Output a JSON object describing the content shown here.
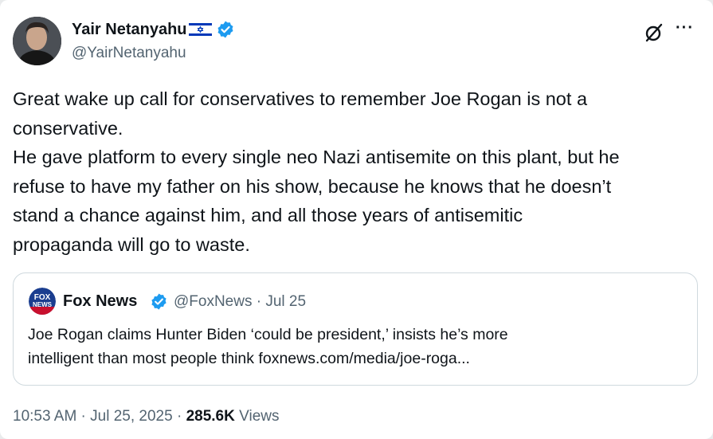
{
  "author": {
    "display_name": "Yair Netanyahu",
    "flag_icon": "israel-flag-icon",
    "verified_icon": "verified-badge-icon",
    "handle": "@YairNetanyahu"
  },
  "header_actions": {
    "grok_icon": "grok-icon",
    "more_label": "···"
  },
  "tweet": {
    "lines": [
      "Great wake up call for conservatives to remember Joe Rogan is not a",
      "conservative.",
      "He gave platform to every single neo Nazi antisemite on this plant, but he",
      "refuse to have my father on his show, because he knows that he doesn’t",
      "stand a chance against him, and all those years of antisemitic",
      "propaganda will go to waste."
    ]
  },
  "quote": {
    "logo_icon": "fox-news-logo-icon",
    "name": "Fox News",
    "handle_date": "@FoxNews · Jul 25",
    "lines": [
      "Joe Rogan claims Hunter Biden ‘could be president,’ insists he’s more",
      "intelligent than most people think foxnews.com/media/joe-roga..."
    ]
  },
  "footer": {
    "timestamp": "10:53 AM · Jul 25, 2025 · ",
    "views_count": "285.6K",
    "views_label": " Views"
  },
  "colors": {
    "text": "#0f1419",
    "secondary": "#536471",
    "verified_blue": "#1d9bf0",
    "border": "#cfd9de",
    "fox_blue": "#1a3d8f",
    "fox_red": "#c8102e"
  }
}
